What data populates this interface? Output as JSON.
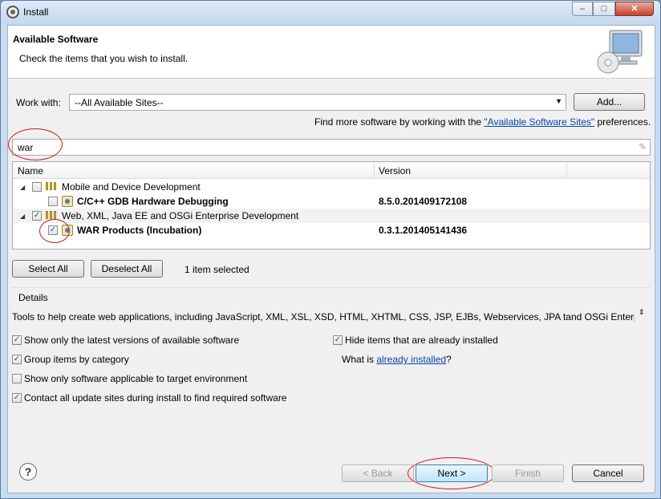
{
  "window": {
    "title": "Install",
    "min_label": "–",
    "max_label": "□",
    "close_label": "✕"
  },
  "header": {
    "title": "Available Software",
    "description": "Check the items that you wish to install."
  },
  "work_with": {
    "label": "Work with:",
    "value": "--All Available Sites--",
    "add_label": "Add..."
  },
  "find_more": {
    "prefix": "Find more software by working with the ",
    "link": "\"Available Software Sites\"",
    "suffix": " preferences."
  },
  "filter": {
    "value": "war"
  },
  "table": {
    "col_name": "Name",
    "col_version": "Version",
    "rows": [
      {
        "name": "Mobile and Device Development",
        "version": "",
        "checked": false
      },
      {
        "name": "C/C++ GDB Hardware Debugging",
        "version": "8.5.0.201409172108",
        "checked": false
      },
      {
        "name": "Web, XML, Java EE and OSGi Enterprise Development",
        "version": "",
        "checked": true
      },
      {
        "name": "WAR Products (Incubation)",
        "version": "0.3.1.201405141436",
        "checked": true
      }
    ]
  },
  "selection": {
    "select_all": "Select All",
    "deselect_all": "Deselect All",
    "status": "1 item selected"
  },
  "details": {
    "label": "Details",
    "text": "Tools to help create web applications, including JavaScript, XML, XSL, XSD, HTML, XHTML, CSS, JSP, EJBs, Webservices, JPA tand OSGi Enterprise"
  },
  "options": {
    "latest": {
      "label": "Show only the latest versions of available software",
      "checked": true
    },
    "group": {
      "label": "Group items by category",
      "checked": true
    },
    "target": {
      "label": "Show only software applicable to target environment",
      "checked": false
    },
    "contact": {
      "label": "Contact all update sites during install to find required software",
      "checked": true
    },
    "hide": {
      "label": "Hide items that are already installed",
      "checked": true
    }
  },
  "what_is": {
    "prefix": "What is ",
    "link": "already installed",
    "suffix": "?"
  },
  "footer": {
    "help": "?",
    "back": "< Back",
    "next": "Next >",
    "finish": "Finish",
    "cancel": "Cancel"
  },
  "colors": {
    "accent": "#0645ad",
    "annotation": "#cc1a1a"
  }
}
